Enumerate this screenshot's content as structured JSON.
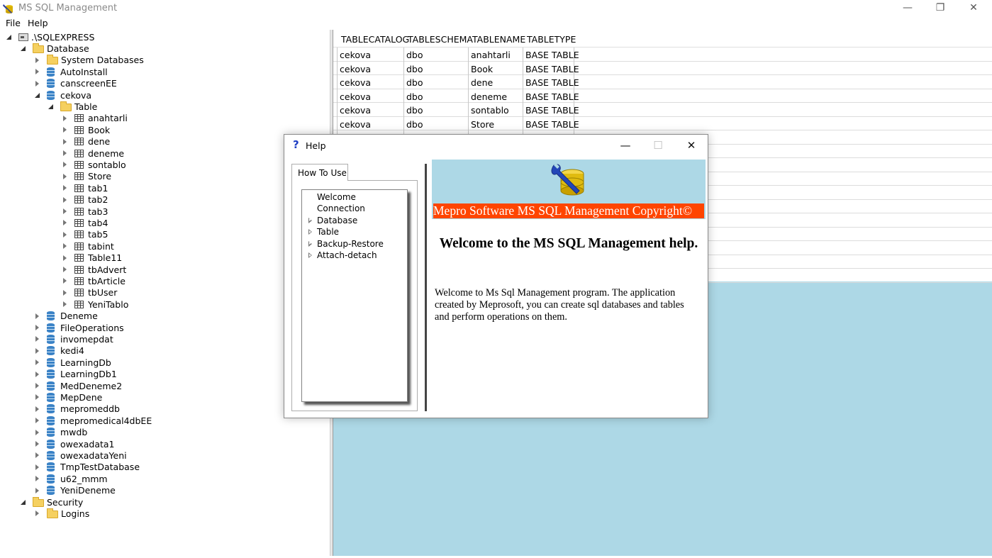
{
  "window": {
    "title": "MS SQL Management",
    "minimize_glyph": "—",
    "restore_glyph": "❐",
    "close_glyph": "✕"
  },
  "menu": {
    "file": "File",
    "help": "Help"
  },
  "tree": {
    "server": ".\\SQLEXPRESS",
    "database_folder": "Database",
    "system_databases": "System Databases",
    "db_before": [
      "AutoInstall",
      "canscreenEE"
    ],
    "expanded_db": "cekova",
    "table_folder": "Table",
    "tables": [
      "anahtarli",
      "Book",
      "dene",
      "deneme",
      "sontablo",
      "Store",
      "tab1",
      "tab2",
      "tab3",
      "tab4",
      "tab5",
      "tabint",
      "Table11",
      "tbAdvert",
      "tbArticle",
      "tbUser",
      "YeniTablo"
    ],
    "db_after": [
      "Deneme",
      "FileOperations",
      "invomepdat",
      "kedi4",
      "LearningDb",
      "LearningDb1",
      "MedDeneme2",
      "MepDene",
      "mepromeddb",
      "mepromedical4dbEE",
      "mwdb",
      "owexadata1",
      "owexadataYeni",
      "TmpTestDatabase",
      "u62_mmm",
      "YeniDeneme"
    ],
    "security_folder": "Security",
    "logins_folder": "Logins"
  },
  "grid": {
    "columns": [
      "TABLECATALOG",
      "TABLESCHEMA",
      "TABLENAME",
      "TABLETYPE"
    ],
    "rows": [
      [
        "cekova",
        "dbo",
        "anahtarli",
        "BASE TABLE"
      ],
      [
        "cekova",
        "dbo",
        "Book",
        "BASE TABLE"
      ],
      [
        "cekova",
        "dbo",
        "dene",
        "BASE TABLE"
      ],
      [
        "cekova",
        "dbo",
        "deneme",
        "BASE TABLE"
      ],
      [
        "cekova",
        "dbo",
        "sontablo",
        "BASE TABLE"
      ],
      [
        "cekova",
        "dbo",
        "Store",
        "BASE TABLE"
      ]
    ]
  },
  "help_dialog": {
    "title": "Help",
    "question_glyph": "?",
    "minimize_glyph": "—",
    "maximize_glyph": "☐",
    "close_glyph": "✕",
    "tab_label": "How To Use",
    "topics": [
      {
        "label": "Welcome",
        "expandable": false
      },
      {
        "label": "Connection",
        "expandable": false
      },
      {
        "label": "Database",
        "expandable": true
      },
      {
        "label": "Table",
        "expandable": true
      },
      {
        "label": "Backup-Restore",
        "expandable": true
      },
      {
        "label": "Attach-detach",
        "expandable": true
      }
    ],
    "banner_text": "Mepro Software MS SQL Management Copyright©",
    "heading": "Welcome to the MS SQL Management help.",
    "body": "Welcome to Ms Sql Management program. The application created by Meprosoft, you can create sql databases and tables and perform operations on them.",
    "banner_color": "#add8e6",
    "banner_text_bg": "#ff4500"
  },
  "colors": {
    "grid_background": "#add8e6"
  }
}
